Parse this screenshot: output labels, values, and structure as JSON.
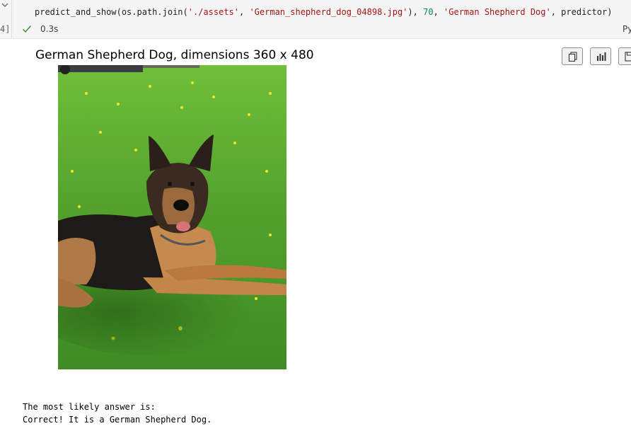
{
  "cell": {
    "code": {
      "fn": "predict_and_show(os.path.join(",
      "arg_path": "'./assets'",
      "sep1": ", ",
      "arg_file": "'German_shepherd_dog_04898.jpg'",
      "sep2": "), ",
      "arg_size": "70",
      "sep3": ", ",
      "arg_label": "'German Shepherd Dog'",
      "tail": ", predictor)"
    },
    "execution_count": "4]",
    "status_time": "0.3s",
    "language_label": "Py"
  },
  "output": {
    "plot_title": "German Shepherd Dog, dimensions 360 x 480",
    "toolbar_icons": [
      "copy-icon",
      "chart-icon",
      "save-icon"
    ],
    "stdout_lines": [
      "The most likely answer is:",
      "Correct! It is a German Shepherd Dog."
    ]
  },
  "colors": {
    "cell_background": "#f5f5f5",
    "string_token": "#a31515",
    "number_token": "#098658",
    "success_check": "#388a34",
    "grass": "#4e9a2c"
  }
}
